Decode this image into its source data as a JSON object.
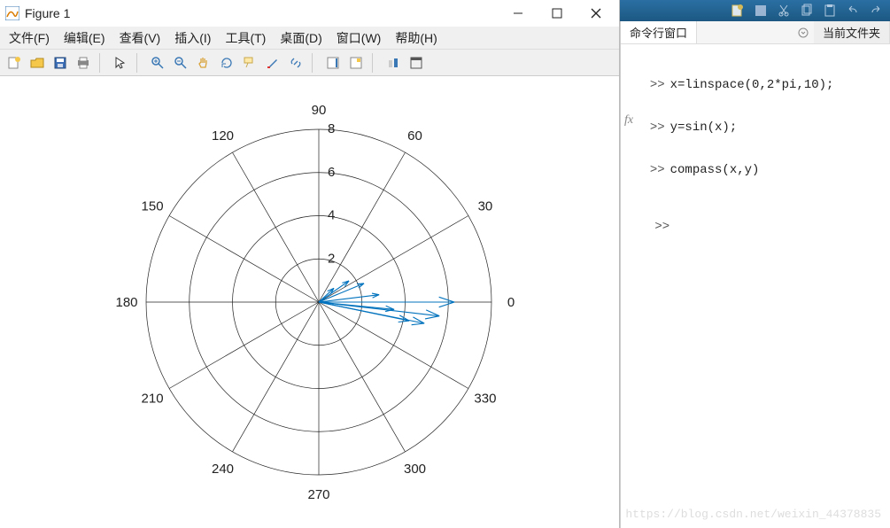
{
  "window": {
    "title": "Figure 1",
    "minimize": "min",
    "maximize": "max",
    "close": "close"
  },
  "menu": {
    "file": "文件(F)",
    "edit": "编辑(E)",
    "view": "查看(V)",
    "insert": "插入(I)",
    "tools": "工具(T)",
    "desktop": "桌面(D)",
    "window": "窗口(W)",
    "help": "帮助(H)"
  },
  "toolbar": {
    "new": "new",
    "open": "open",
    "save": "save",
    "print": "print",
    "pointer": "pointer",
    "zoomin": "zoomin",
    "zoomout": "zoomout",
    "pan": "pan",
    "rotate": "rotate",
    "datatip": "datatip",
    "brush": "brush",
    "link": "link",
    "colorbar": "colorbar",
    "legend": "legend",
    "hide": "hide",
    "dock": "dock"
  },
  "panel": {
    "tab_cmd": "命令行窗口",
    "tab_folder": "当前文件夹"
  },
  "cmd": {
    "line1": "x=linspace(0,2*pi,10);",
    "line2": "y=sin(x);",
    "line3": "compass(x,y)",
    "prompt": ">>"
  },
  "watermark": "https://blog.csdn.net/weixin_44378835",
  "chart_data": {
    "type": "compass",
    "angle_labels_deg": [
      0,
      30,
      60,
      90,
      120,
      150,
      180,
      210,
      240,
      270,
      300,
      330
    ],
    "radial_ticks": [
      2,
      4,
      6,
      8
    ],
    "rlim": [
      0,
      8
    ],
    "series": [
      {
        "name": "compass(x,y)",
        "vectors": [
          {
            "x": 0.0,
            "y": 0.0
          },
          {
            "x": 0.698,
            "y": 0.643
          },
          {
            "x": 1.396,
            "y": 0.985
          },
          {
            "x": 2.094,
            "y": 0.866
          },
          {
            "x": 2.793,
            "y": 0.342
          },
          {
            "x": 3.491,
            "y": -0.342
          },
          {
            "x": 4.189,
            "y": -0.866
          },
          {
            "x": 4.887,
            "y": -0.985
          },
          {
            "x": 5.585,
            "y": -0.643
          },
          {
            "x": 6.283,
            "y": 0.0
          }
        ],
        "magnitudes": [
          0.0,
          0.949,
          1.709,
          2.266,
          2.814,
          3.508,
          4.277,
          4.985,
          5.622,
          6.283
        ],
        "angles_deg": [
          0.0,
          42.6,
          35.2,
          22.5,
          7.0,
          -5.6,
          -11.7,
          -11.4,
          -6.6,
          0.0
        ]
      }
    ],
    "title": "",
    "xlabel": "",
    "ylabel": ""
  }
}
